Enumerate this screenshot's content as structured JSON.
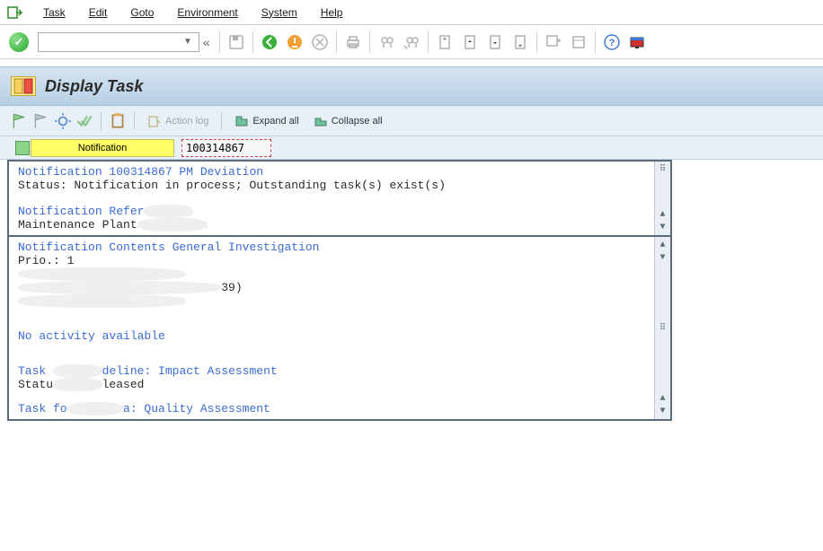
{
  "menu": {
    "task": "Task",
    "edit": "Edit",
    "goto": "Goto",
    "environment": "Environment",
    "system": "System",
    "help": "Help"
  },
  "header": {
    "title": "Display Task"
  },
  "subtoolbar": {
    "action_log": "Action log",
    "expand_all": "Expand all",
    "collapse_all": "Collapse all"
  },
  "notif": {
    "label": "Notification",
    "value": "100314867"
  },
  "panel": {
    "sec1_line1": "Notification 100314867 PM Deviation",
    "sec1_line2": "Status: Notification in process; Outstanding task(s) exist(s)",
    "sec2_line1": "Notification Refer",
    "sec2_line2": "Maintenance Plant",
    "sec3_line1": "Notification Contents General Investigation",
    "sec3_line2": "Prio.: 1",
    "sec3_line3_tail": "39)",
    "sec4_line1": "No activity available",
    "sec5_line1a": "Task",
    "sec5_line1b": "deline: Impact Assessment",
    "sec5_line2a": "Statu",
    "sec5_line2b": "leased",
    "sec6_line1a": "Task fo",
    "sec6_line1b": "a: Quality Assessment"
  }
}
